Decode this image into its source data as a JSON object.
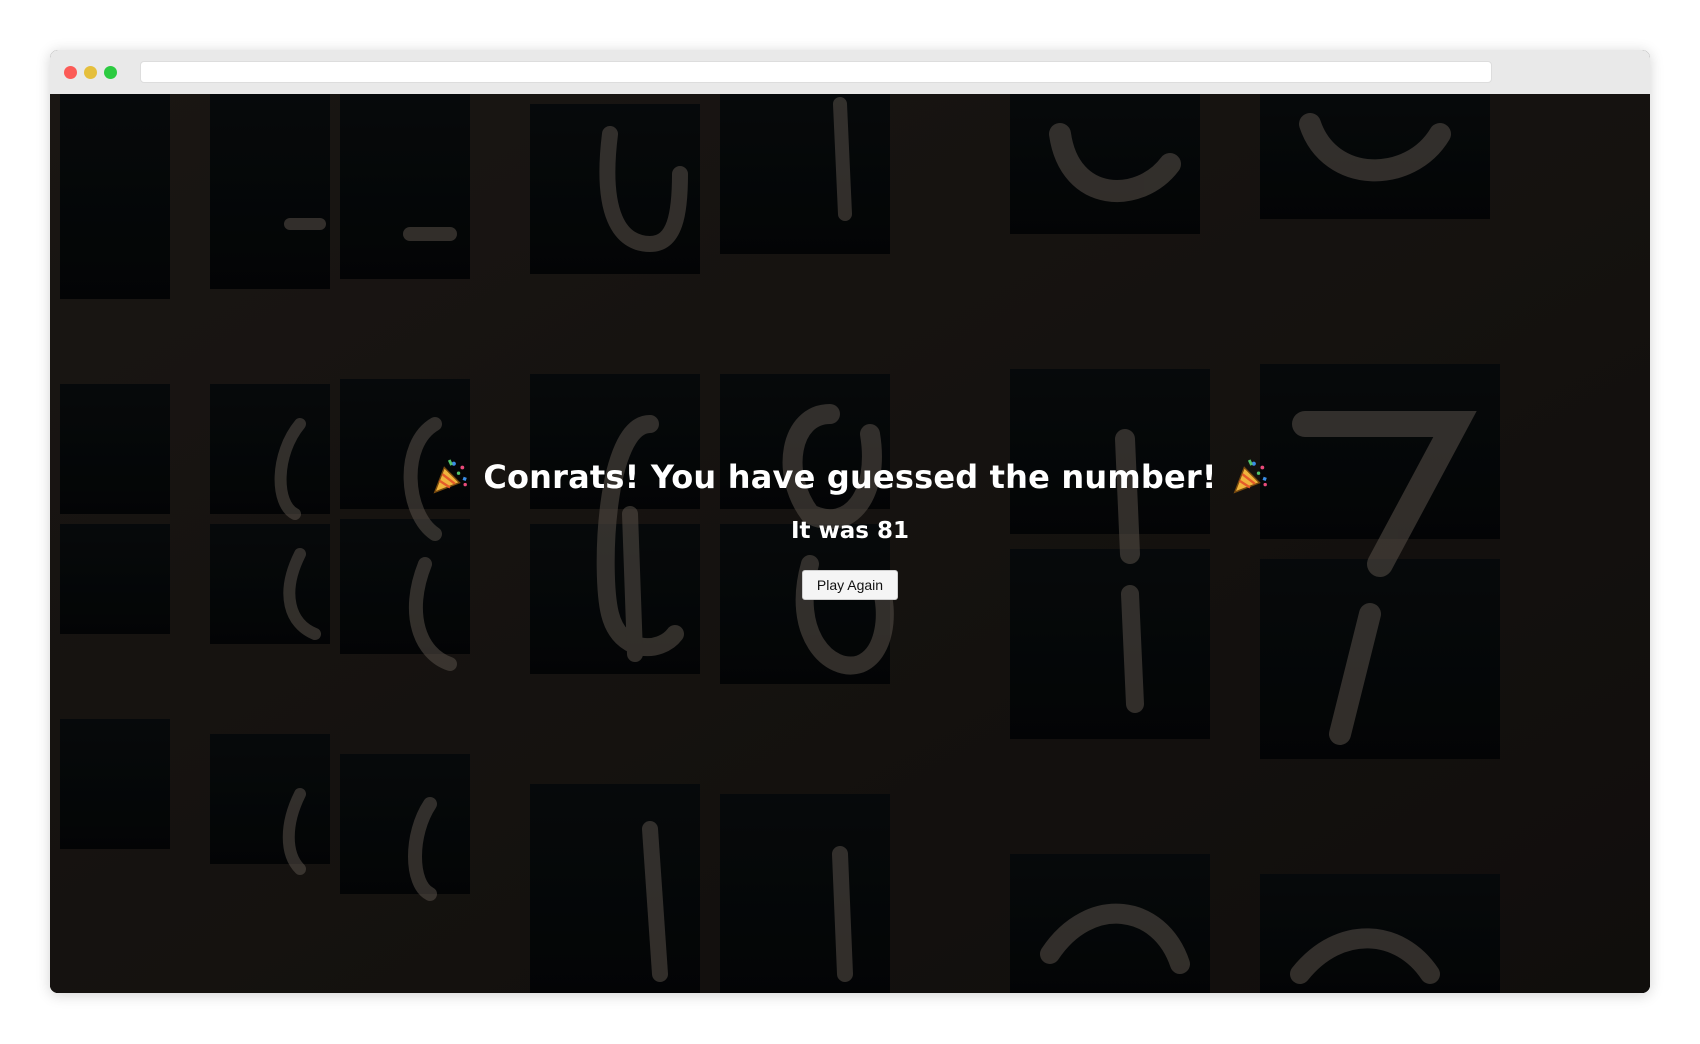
{
  "browser": {
    "address": ""
  },
  "game": {
    "headline": "Conrats! You have guessed the number!",
    "headline_icon": "party-popper-icon",
    "result_text": "It was 81",
    "play_again_label": "Play Again"
  },
  "colors": {
    "overlay_text": "#ffffff",
    "button_bg": "#f5f5f5"
  }
}
